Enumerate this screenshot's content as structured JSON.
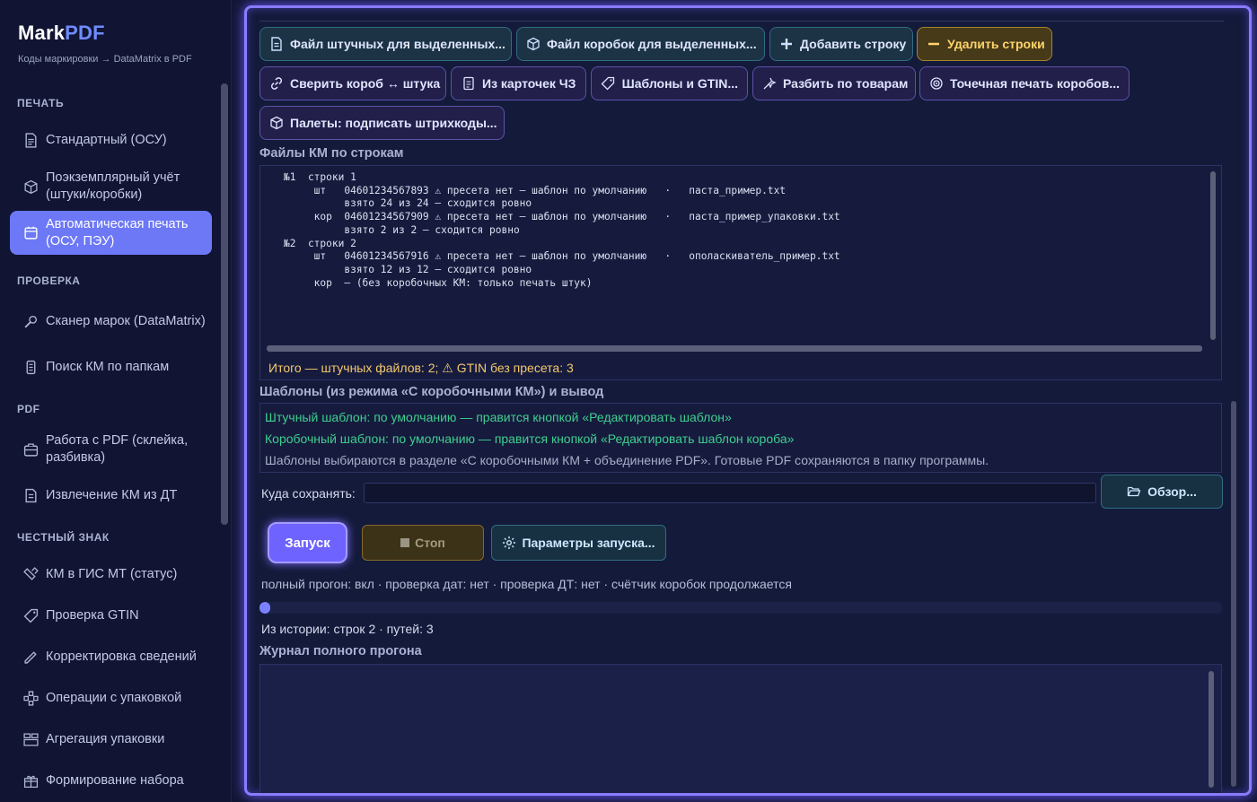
{
  "brand": {
    "name_main": "Mark",
    "name_accent": "PDF",
    "subtitle": "Коды маркировки → DataMatrix в PDF"
  },
  "sidebar": {
    "sections": [
      {
        "title": "ПЕЧАТЬ",
        "items": [
          {
            "label": "Стандартный (ОСУ)",
            "icon": "document-icon"
          },
          {
            "label": "Поэкземплярный учёт (штуки/коробки)",
            "icon": "cube-icon"
          },
          {
            "label": "Автоматическая печать (ОСУ, ПЭУ)",
            "icon": "auto-print-icon",
            "active": true
          }
        ]
      },
      {
        "title": "ПРОВЕРКА",
        "items": [
          {
            "label": "Сканер марок (DataMatrix)",
            "icon": "scanner-icon"
          },
          {
            "label": "Поиск КМ по папкам",
            "icon": "folder-search-icon"
          }
        ]
      },
      {
        "title": "PDF",
        "items": [
          {
            "label": "Работа с PDF (склейка, разбивка)",
            "icon": "pdf-tools-icon"
          },
          {
            "label": "Извлечение КМ из ДТ",
            "icon": "extract-icon"
          }
        ]
      },
      {
        "title": "ЧЕСТНЫЙ ЗНАК",
        "items": [
          {
            "label": "КМ в ГИС МТ (статус)",
            "icon": "gis-status-icon"
          },
          {
            "label": "Проверка GTIN",
            "icon": "tag-icon"
          },
          {
            "label": "Корректировка сведений",
            "icon": "pencil-icon"
          },
          {
            "label": "Операции с упаковкой",
            "icon": "packaging-icon"
          },
          {
            "label": "Агрегация упаковки",
            "icon": "aggregation-icon"
          },
          {
            "label": "Формирование набора",
            "icon": "gift-icon"
          }
        ]
      }
    ]
  },
  "toolbar": {
    "row1": [
      {
        "label": "Файл штучных для выделенных...",
        "icon": "file-icon",
        "style": "teal"
      },
      {
        "label": "Файл коробок для выделенных...",
        "icon": "box-icon",
        "style": "teal"
      },
      {
        "label": "Добавить строку",
        "icon": "plus-icon",
        "style": "teal"
      },
      {
        "label": "Удалить строки",
        "icon": "minus-icon",
        "style": "yellow"
      }
    ],
    "row2": [
      {
        "label": "Сверить короб ↔ штука",
        "icon": "link-icon",
        "style": "purple"
      },
      {
        "label": "Из карточек ЧЗ",
        "icon": "card-icon",
        "style": "purple"
      },
      {
        "label": "Шаблоны и GTIN...",
        "icon": "tag-icon",
        "style": "purple"
      },
      {
        "label": "Разбить по товарам",
        "icon": "split-icon",
        "style": "purple"
      },
      {
        "label": "Точечная печать коробов...",
        "icon": "target-icon",
        "style": "purple"
      }
    ],
    "row3": [
      {
        "label": "Палеты: подписать штрихкоды...",
        "icon": "box-icon",
        "style": "purple"
      }
    ]
  },
  "km_files": {
    "title": "Файлы КМ по строкам",
    "log": "№1  строки 1\n     шт   04601234567893 ⚠ пресета нет — шаблон по умолчанию   ·   паста_пример.txt\n          взято 24 из 24 — сходится ровно\n     кор  04601234567909 ⚠ пресета нет — шаблон по умолчанию   ·   паста_пример_упаковки.txt\n          взято 2 из 2 — сходится ровно\n№2  строки 2\n     шт   04601234567916 ⚠ пресета нет — шаблон по умолчанию   ·   ополаскиватель_пример.txt\n          взято 12 из 12 — сходится ровно\n     кор  — (без коробочных КМ: только печать штук)",
    "total": "Итого — штучных файлов: 2;  ⚠  GTIN без пресета: 3"
  },
  "templates": {
    "title": "Шаблоны (из режима «С коробочными КМ») и вывод",
    "unit_template": "Штучный шаблон: по умолчанию — правится кнопкой «Редактировать шаблон»",
    "box_template": "Коробочный шаблон: по умолчанию — правится кнопкой «Редактировать шаблон короба»",
    "note": "Шаблоны выбираются в разделе «С коробочными КМ + объединение PDF». Готовые PDF сохраняются в папку программы."
  },
  "save": {
    "label": "Куда сохранять:",
    "value": "",
    "browse_label": "Обзор..."
  },
  "actions": {
    "run_label": "Запуск",
    "stop_label": "Стоп",
    "params_label": "Параметры запуска..."
  },
  "status": "полный прогон: вкл · проверка дат: нет · проверка ДТ: нет · счётчик коробок продолжается",
  "progress_fraction": 0.01,
  "history": "Из истории: строк 2 · путей: 3",
  "journal": {
    "title": "Журнал полного прогона",
    "content": ""
  }
}
